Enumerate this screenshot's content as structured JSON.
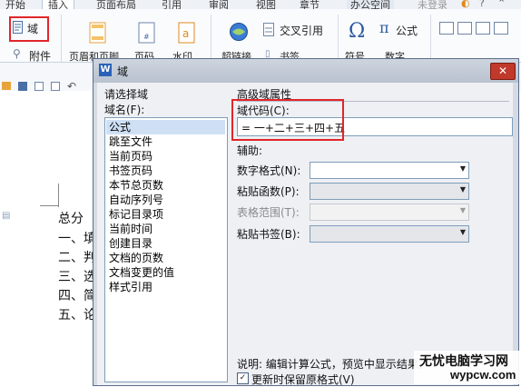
{
  "ribbon": {
    "tabs": [
      "开始",
      "插入",
      "页面布局",
      "引用",
      "审阅",
      "视图",
      "章节",
      "办公空间",
      "未登录"
    ],
    "field_button": "域",
    "attachment_button": "附件",
    "header_footer": "页眉和页脚",
    "page_number": "页码",
    "watermark": "水印",
    "cross_reference": "交叉引用",
    "hyperlink": "超链接",
    "bookmark": "书签",
    "symbol": "符号",
    "formula": "公式",
    "number": "数字"
  },
  "document": {
    "lines": [
      "总分",
      "一、填",
      "二、判",
      "三、选",
      "四、简",
      "五、论"
    ]
  },
  "dialog": {
    "title": "域",
    "choose_field_label": "请选择域",
    "field_name_label": "域名(F):",
    "fields": [
      "公式",
      "跳至文件",
      "当前页码",
      "书签页码",
      "本节总页数",
      "自动序列号",
      "标记目录项",
      "当前时间",
      "创建目录",
      "文档的页数",
      "文档变更的值",
      "样式引用"
    ],
    "selected_field": "公式",
    "advanced_label": "高级域属性",
    "field_code_label": "域代码(C):",
    "field_code_value": "= 一+二+三+四+五",
    "helper_label": "辅助:",
    "number_format_label": "数字格式(N):",
    "paste_function_label": "粘贴函数(P):",
    "table_range_label": "表格范围(T):",
    "paste_bookmark_label": "粘贴书签(B):",
    "description": "说明: 编辑计算公式，预览中显示结果。",
    "preserve_format_label": "更新时保留原格式(V)",
    "preserve_format_checked": true
  },
  "watermark_text": {
    "line1": "无忧电脑学习网",
    "line2": "wypcw.com"
  },
  "colors": {
    "highlight_border": "#e0262b",
    "selection": "#cfe0f5",
    "title_bar": "#b9c2cf"
  }
}
